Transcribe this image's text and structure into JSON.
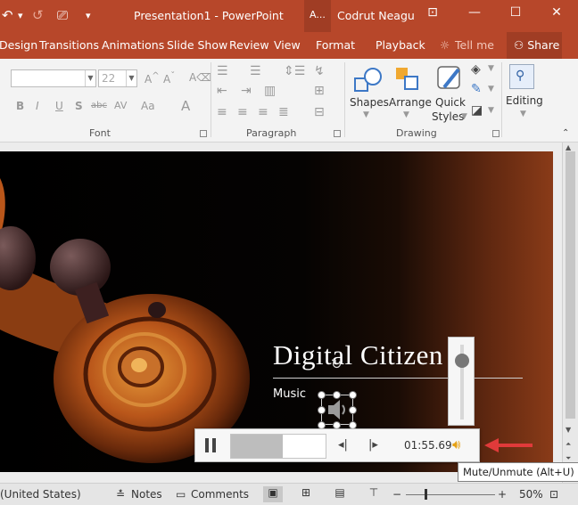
{
  "app": {
    "title": "Presentation1 - PowerPoint",
    "context_tab_group": "A...",
    "user": "Codrut Neagu"
  },
  "qat": {
    "undo": "↶",
    "redo": "↺",
    "from_beginning": "⎚",
    "customize": "▾"
  },
  "window_buttons": {
    "restore_ribbon": "⊡",
    "minimize": "—",
    "maximize": "☐",
    "close": "✕"
  },
  "tabs": [
    {
      "label": "Design"
    },
    {
      "label": "Transitions"
    },
    {
      "label": "Animations"
    },
    {
      "label": "Slide Show"
    },
    {
      "label": "Review"
    },
    {
      "label": "View"
    },
    {
      "label": "Format"
    },
    {
      "label": "Playback"
    },
    {
      "label": "Tell me"
    }
  ],
  "share_label": "Share",
  "ribbon": {
    "font": {
      "label": "Font",
      "size_placeholder": "22",
      "buttons": [
        "B",
        "I",
        "U",
        "S",
        "abc",
        "AV",
        "Aa",
        "A"
      ]
    },
    "paragraph": {
      "label": "Paragraph"
    },
    "drawing": {
      "label": "Drawing",
      "shapes": "Shapes",
      "arrange": "Arrange",
      "quick_styles_1": "Quick",
      "quick_styles_2": "Styles"
    },
    "editing": {
      "label": "Editing"
    }
  },
  "slide": {
    "title": "Digital Citizen",
    "subtitle": "Music"
  },
  "player": {
    "time": "01:55.69",
    "progress": 0.55,
    "volume": 0.85
  },
  "tooltip": "Mute/Unmute (Alt+U)",
  "statusbar": {
    "language": "(United States)",
    "notes": "Notes",
    "comments": "Comments",
    "zoom": "50%"
  },
  "colors": {
    "accent": "#b7472a",
    "volume_icon": "#e6a115",
    "arrow": "#e03a3a"
  }
}
